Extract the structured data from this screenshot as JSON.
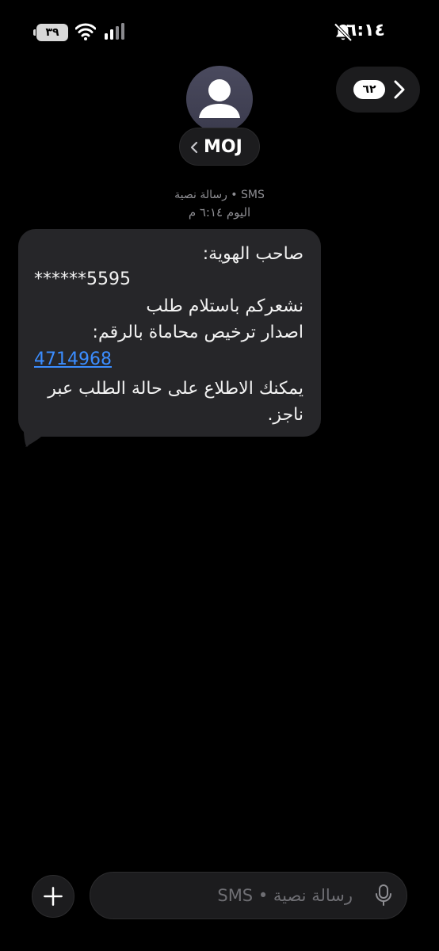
{
  "status_bar": {
    "time": "٦:١٤",
    "battery": "٣٩",
    "icons": [
      "bell-slash-icon",
      "wifi-icon",
      "cellular-signal-icon"
    ]
  },
  "header": {
    "back_count": "٦٢",
    "contact_name": "MOJ",
    "icons": [
      "chevron-right-icon",
      "person-icon",
      "chevron-left-icon"
    ]
  },
  "meta": {
    "type": "رسالة نصية • SMS",
    "date": "اليوم ٦:١٤ م"
  },
  "message": {
    "line1": "صاحب الهوية:",
    "line2": "******5595",
    "line3": "نشعركم باستلام طلب",
    "line4": "اصدار ترخيص محاماة بالرقم:",
    "link": "4714968",
    "line6": "يمكنك الاطلاع على حالة الطلب عبر",
    "line7": "ناجز."
  },
  "composer": {
    "placeholder": "رسالة نصية • SMS",
    "icons": [
      "plus-icon",
      "microphone-icon"
    ]
  },
  "colors": {
    "background": "#000000",
    "bubble": "#262629",
    "link": "#3b8dff",
    "muted_text": "#8e8e93"
  }
}
